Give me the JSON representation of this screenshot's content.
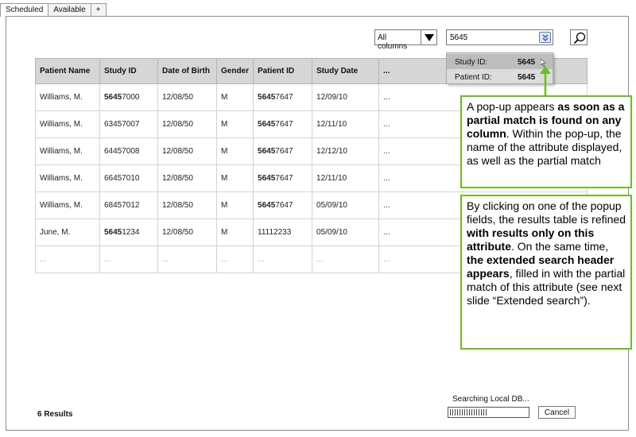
{
  "tabs": [
    {
      "label": "Scheduled"
    },
    {
      "label": "Available"
    },
    {
      "label": "+"
    }
  ],
  "toolbar": {
    "column_select_value": "All columns",
    "search_value": "5645"
  },
  "table": {
    "headers": [
      "Patient Name",
      "Study ID",
      "Date of Birth",
      "Gender",
      "Patient ID",
      "Study Date",
      "..."
    ],
    "rows": [
      {
        "name": "Williams, M.",
        "study_id_match": "5645",
        "study_id_rest": "7000",
        "dob": "12/08/50",
        "gender": "M",
        "patient_id_match": "5645",
        "patient_id_rest": "7647",
        "study_date": "12/09/10",
        "more": "..."
      },
      {
        "name": "Williams, M.",
        "study_id_match": "",
        "study_id_rest": "63457007",
        "dob": "12/08/50",
        "gender": "M",
        "patient_id_match": "5645",
        "patient_id_rest": "7647",
        "study_date": "12/11/10",
        "more": "..."
      },
      {
        "name": "Williams, M.",
        "study_id_match": "",
        "study_id_rest": "64457008",
        "dob": "12/08/50",
        "gender": "M",
        "patient_id_match": "5645",
        "patient_id_rest": "7647",
        "study_date": "12/12/10",
        "more": "..."
      },
      {
        "name": "Williams, M.",
        "study_id_match": "",
        "study_id_rest": "66457010",
        "dob": "12/08/50",
        "gender": "M",
        "patient_id_match": "5645",
        "patient_id_rest": "7647",
        "study_date": "12/11/10",
        "more": "..."
      },
      {
        "name": "Williams, M.",
        "study_id_match": "",
        "study_id_rest": "68457012",
        "dob": "12/08/50",
        "gender": "M",
        "patient_id_match": "5645",
        "patient_id_rest": "7647",
        "study_date": "05/09/10",
        "more": "..."
      },
      {
        "name": "June, M.",
        "study_id_match": "5645",
        "study_id_rest": "1234",
        "dob": "12/08/50",
        "gender": "M",
        "patient_id_match": "",
        "patient_id_rest": "11112233",
        "study_date": "05/09/10",
        "more": "..."
      },
      {
        "name": "...",
        "study_id_match": "",
        "study_id_rest": "...",
        "dob": "...",
        "gender": "...",
        "patient_id_match": "",
        "patient_id_rest": "...",
        "study_date": "...",
        "more": "..."
      }
    ]
  },
  "popup": {
    "items": [
      {
        "label": "Study ID:",
        "value": "5645"
      },
      {
        "label": "Patient ID:",
        "value": "5645"
      }
    ]
  },
  "notes": {
    "note1": {
      "t1": "A pop-up appears ",
      "b1": "as soon as a partial match is found on any column",
      "t2": ". Within the pop-up, the name of the attribute displayed, as well as the partial match"
    },
    "note2": {
      "t1": "By clicking on one of the popup fields, the results table is refined ",
      "b1": "with results only on this attribute",
      "t2": ". On the same time, ",
      "b2": "the extended search header appears",
      "t3": ", filled in with the partial match of this attribute (see next slide “Extended search”)."
    }
  },
  "footer": {
    "results_label": "6 Results",
    "searching_label": "Searching Local DB...",
    "progress": 0.47,
    "cancel_label": "Cancel"
  },
  "colors": {
    "note_border": "#6abf1c",
    "header_bg": "#d6d6d6",
    "popup_bg": "#dcdcdc"
  }
}
